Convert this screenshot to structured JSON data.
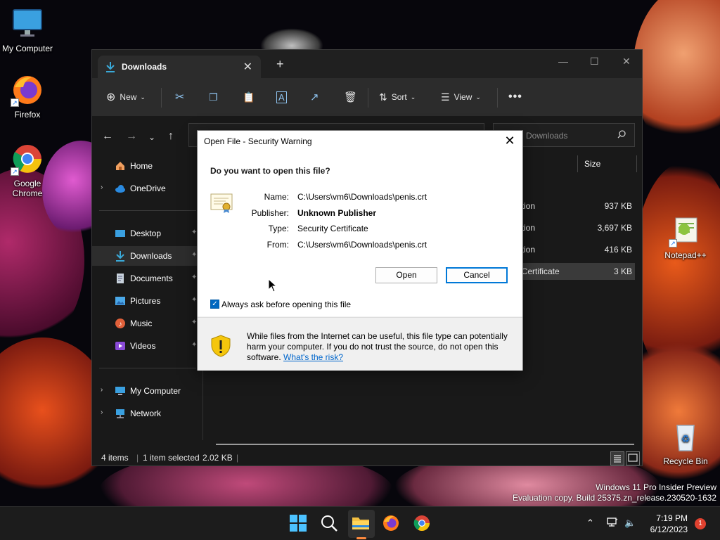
{
  "desktop": {
    "icons": [
      {
        "label": "My Computer"
      },
      {
        "label": "Firefox"
      },
      {
        "label": "Google Chrome"
      },
      {
        "label": "Notepad++"
      },
      {
        "label": "Recycle Bin"
      }
    ],
    "watermark_line1": "Windows 11 Pro Insider Preview",
    "watermark_line2": "Evaluation copy. Build 25375.zn_release.230520-1632"
  },
  "explorer": {
    "tab_label": "Downloads",
    "toolbar": {
      "new_label": "New",
      "sort_label": "Sort",
      "view_label": "View"
    },
    "search_placeholder": "Downloads",
    "sidebar": {
      "home": "Home",
      "onedrive": "OneDrive",
      "desktop": "Desktop",
      "downloads": "Downloads",
      "documents": "Documents",
      "pictures": "Pictures",
      "music": "Music",
      "videos": "Videos",
      "my_computer": "My Computer",
      "network": "Network"
    },
    "columns": {
      "size": "Size"
    },
    "rows": [
      {
        "type": "cation",
        "size": "937 KB"
      },
      {
        "type": "cation",
        "size": "3,697 KB"
      },
      {
        "type": "cation",
        "size": "416 KB"
      },
      {
        "type": "ty Certificate",
        "size": "3 KB"
      }
    ],
    "status": {
      "items": "4 items",
      "selected": "1 item selected",
      "size": "2.02 KB"
    }
  },
  "dialog": {
    "title": "Open File - Security Warning",
    "question": "Do you want to open this file?",
    "name_label": "Name:",
    "name_value": "C:\\Users\\vm6\\Downloads\\penis.crt",
    "publisher_label": "Publisher:",
    "publisher_value": "Unknown Publisher",
    "type_label": "Type:",
    "type_value": "Security Certificate",
    "from_label": "From:",
    "from_value": "C:\\Users\\vm6\\Downloads\\penis.crt",
    "open_label": "Open",
    "cancel_label": "Cancel",
    "checkbox_label": "Always ask before opening this file",
    "checkbox_checked": true,
    "warning_text": "While files from the Internet can be useful, this file type can potentially harm your computer. If you do not trust the source, do not open this software.",
    "risk_link": "What's the risk?"
  },
  "taskbar": {
    "time": "7:19 PM",
    "date": "6/12/2023",
    "notification_count": "1"
  },
  "colors": {
    "accent": "#0067c0",
    "link": "#0066cc",
    "taskbar_indicator": "#ff8a3d",
    "badge": "#e0412f"
  }
}
